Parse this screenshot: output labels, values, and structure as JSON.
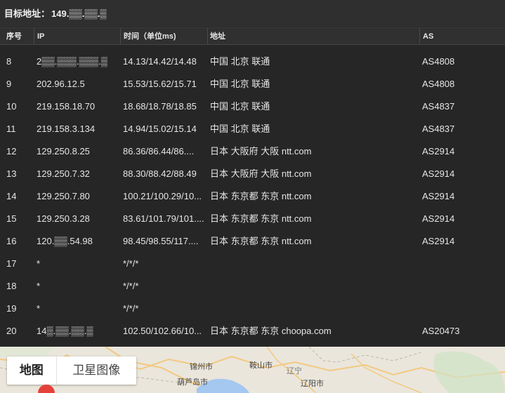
{
  "header": {
    "label": "目标地址：",
    "ip": "149.▒▒.▒▒.▒"
  },
  "table": {
    "columns": [
      "序号",
      "IP",
      "时间（单位ms)",
      "地址",
      "AS"
    ],
    "rows": [
      {
        "no": "8",
        "ip": "2▒▒.▒▒▒.▒▒▒.▒",
        "time": "14.13/14.42/14.48",
        "addr": "中国 北京 联通",
        "as": "AS4808"
      },
      {
        "no": "9",
        "ip": "202.96.12.5",
        "time": "15.53/15.62/15.71",
        "addr": "中国 北京 联通",
        "as": "AS4808"
      },
      {
        "no": "10",
        "ip": "219.158.18.70",
        "time": "18.68/18.78/18.85",
        "addr": "中国 北京 联通",
        "as": "AS4837"
      },
      {
        "no": "11",
        "ip": "219.158.3.134",
        "time": "14.94/15.02/15.14",
        "addr": "中国 北京 联通",
        "as": "AS4837"
      },
      {
        "no": "12",
        "ip": "129.250.8.25",
        "time": "86.36/86.44/86....",
        "addr": "日本 大阪府 大阪 ntt.com",
        "as": "AS2914"
      },
      {
        "no": "13",
        "ip": "129.250.7.32",
        "time": "88.30/88.42/88.49",
        "addr": "日本 大阪府 大阪 ntt.com",
        "as": "AS2914"
      },
      {
        "no": "14",
        "ip": "129.250.7.80",
        "time": "100.21/100.29/10...",
        "addr": "日本 东京都 东京 ntt.com",
        "as": "AS2914"
      },
      {
        "no": "15",
        "ip": "129.250.3.28",
        "time": "83.61/101.79/101....",
        "addr": "日本 东京都 东京 ntt.com",
        "as": "AS2914"
      },
      {
        "no": "16",
        "ip": "120.▒▒.54.98",
        "time": "98.45/98.55/117....",
        "addr": "日本 东京都 东京 ntt.com",
        "as": "AS2914"
      },
      {
        "no": "17",
        "ip": "*",
        "time": "*/*/*",
        "addr": "",
        "as": ""
      },
      {
        "no": "18",
        "ip": "*",
        "time": "*/*/*",
        "addr": "",
        "as": ""
      },
      {
        "no": "19",
        "ip": "*",
        "time": "*/*/*",
        "addr": "",
        "as": ""
      },
      {
        "no": "20",
        "ip": "14▒.▒▒.▒▒.▒",
        "time": "102.50/102.66/10...",
        "addr": "日本 东京都 东京 choopa.com",
        "as": "AS20473"
      }
    ]
  },
  "map": {
    "tab_map": "地图",
    "tab_satellite": "卫星图像",
    "cities": [
      "锦州市",
      "鞍山市",
      "辽宁",
      "葫芦岛市",
      "辽阳市"
    ],
    "water_color": "#a4c8f0",
    "land_color": "#eae6dc",
    "pin_color": "#e5413a"
  }
}
